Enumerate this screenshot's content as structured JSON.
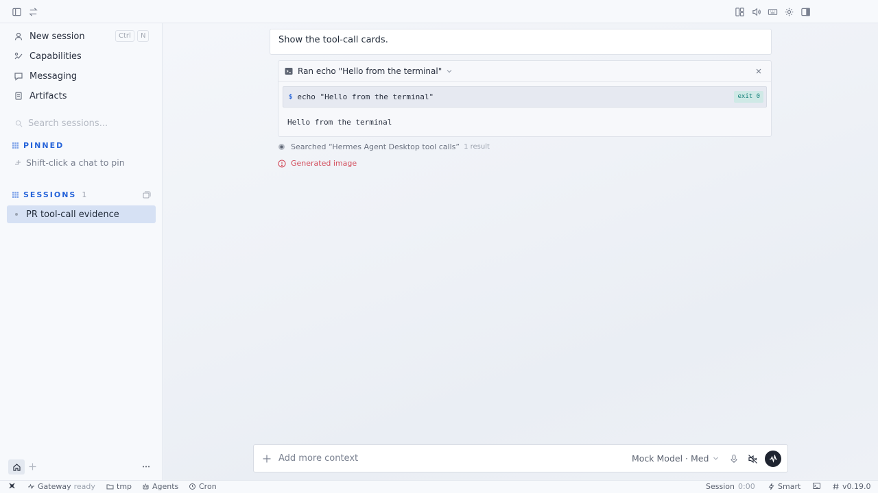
{
  "sidebar": {
    "nav": [
      {
        "label": "New session",
        "icon": "new-session-icon",
        "shortcut": [
          "Ctrl",
          "N"
        ]
      },
      {
        "label": "Capabilities",
        "icon": "capabilities-icon"
      },
      {
        "label": "Messaging",
        "icon": "messaging-icon"
      },
      {
        "label": "Artifacts",
        "icon": "artifacts-icon"
      }
    ],
    "search_placeholder": "Search sessions...",
    "pinned": {
      "title": "PINNED",
      "hint": "Shift-click a chat to pin"
    },
    "sessions": {
      "title": "SESSIONS",
      "count": "1",
      "items": [
        "PR tool-call evidence"
      ]
    }
  },
  "chat": {
    "user_message": "Show the tool-call cards.",
    "tool_card": {
      "title": "Ran echo \"Hello from the terminal\"",
      "command": "echo \"Hello from the terminal\"",
      "prompt_symbol": "$",
      "exit_badge": "exit 0",
      "output": "Hello from the terminal"
    },
    "search_result": {
      "text": "Searched “Hermes Agent Desktop tool calls”",
      "count": "1 result"
    },
    "generated_image": {
      "text": "Generated image",
      "status_color": "#d24b5a"
    }
  },
  "composer": {
    "placeholder": "Add more context",
    "model": "Mock Model · Med"
  },
  "statusbar": {
    "gateway_label": "Gateway",
    "gateway_status": "ready",
    "folder": "tmp",
    "agents": "Agents",
    "cron": "Cron",
    "session_label": "Session",
    "session_time": "0:00",
    "mode": "Smart",
    "version": "v0.19.0"
  },
  "colors": {
    "accent": "#2563d9",
    "selected": "#d6e1f4",
    "exit_ok": "#16807a"
  }
}
